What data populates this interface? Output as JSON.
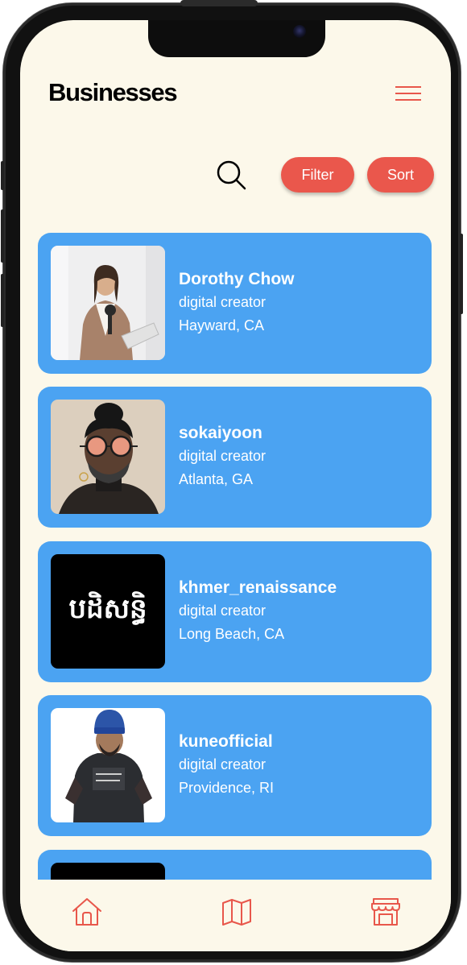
{
  "header": {
    "title": "Businesses"
  },
  "toolbar": {
    "filter_label": "Filter",
    "sort_label": "Sort"
  },
  "colors": {
    "accent": "#ea574c",
    "card": "#4ba3f2",
    "background": "#fcf8ea"
  },
  "businesses": [
    {
      "name": "Dorothy Chow",
      "category": "digital creator",
      "location": "Hayward, CA"
    },
    {
      "name": "sokaiyoon",
      "category": "digital creator",
      "location": "Atlanta, GA"
    },
    {
      "name": "khmer_renaissance",
      "category": "digital creator",
      "location": "Long Beach, CA",
      "logo_text": "បដិសន្ធិ"
    },
    {
      "name": "kuneofficial",
      "category": "digital creator",
      "location": "Providence, RI"
    }
  ],
  "tabs": [
    {
      "icon": "home-icon"
    },
    {
      "icon": "map-icon"
    },
    {
      "icon": "store-icon"
    }
  ]
}
